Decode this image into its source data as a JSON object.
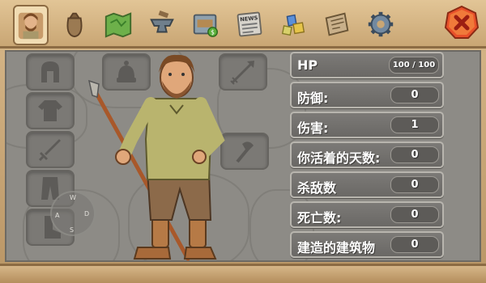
{
  "tabs": [
    {
      "name": "character",
      "icon": "character-portrait-icon"
    },
    {
      "name": "inventory",
      "icon": "sack-icon"
    },
    {
      "name": "map",
      "icon": "map-icon"
    },
    {
      "name": "crafting",
      "icon": "anvil-icon"
    },
    {
      "name": "shop",
      "icon": "shop-icon"
    },
    {
      "name": "news",
      "icon": "newspaper-icon",
      "label": "NEWS"
    },
    {
      "name": "gems",
      "icon": "gems-icon"
    },
    {
      "name": "journal",
      "icon": "journal-icon"
    },
    {
      "name": "settings",
      "icon": "gear-icon"
    }
  ],
  "stats": {
    "hp": {
      "label": "HP",
      "value": "100 / 100"
    },
    "defense": {
      "label": "防御:",
      "value": "0"
    },
    "damage": {
      "label": "伤害:",
      "value": "1"
    },
    "days": {
      "label": "你活着的天数:",
      "value": "0"
    },
    "kills": {
      "label": "杀敌数",
      "value": "0"
    },
    "deaths": {
      "label": "死亡数:",
      "value": "0"
    },
    "buildings": {
      "label": "建造的建筑物",
      "value": "0"
    }
  },
  "joystick": {
    "w": "W",
    "a": "A",
    "s": "S",
    "d": "D"
  },
  "colors": {
    "stone": "#8d8b86",
    "frame": "#c9a674",
    "close": "#e8502a"
  }
}
